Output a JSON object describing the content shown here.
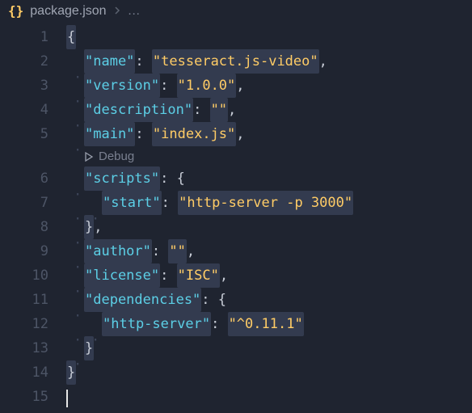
{
  "breadcrumb": {
    "filename": "package.json",
    "ellipsis": "…"
  },
  "codelens": {
    "label": "Debug"
  },
  "code": {
    "keys": {
      "name": "\"name\"",
      "version": "\"version\"",
      "description": "\"description\"",
      "main": "\"main\"",
      "scripts": "\"scripts\"",
      "start": "\"start\"",
      "author": "\"author\"",
      "license": "\"license\"",
      "dependencies": "\"dependencies\"",
      "httpserver": "\"http-server\""
    },
    "values": {
      "name": "\"tesseract.js-video\"",
      "version": "\"1.0.0\"",
      "description": "\"\"",
      "main": "\"index.js\"",
      "start": "\"http-server -p 3000\"",
      "author": "\"\"",
      "license": "\"ISC\"",
      "httpserver": "\"^0.11.1\""
    },
    "punct": {
      "colon": ":",
      "comma": ",",
      "lbrace": "{",
      "rbrace": "}"
    }
  },
  "chart_data": {
    "type": "table",
    "title": "package.json",
    "rows": [
      {
        "key": "name",
        "value": "tesseract.js-video"
      },
      {
        "key": "version",
        "value": "1.0.0"
      },
      {
        "key": "description",
        "value": ""
      },
      {
        "key": "main",
        "value": "index.js"
      },
      {
        "key": "scripts.start",
        "value": "http-server -p 3000"
      },
      {
        "key": "author",
        "value": ""
      },
      {
        "key": "license",
        "value": "ISC"
      },
      {
        "key": "dependencies.http-server",
        "value": "^0.11.1"
      }
    ]
  },
  "line_numbers": [
    "1",
    "2",
    "3",
    "4",
    "5",
    "6",
    "7",
    "8",
    "9",
    "10",
    "11",
    "12",
    "13",
    "14",
    "15"
  ]
}
